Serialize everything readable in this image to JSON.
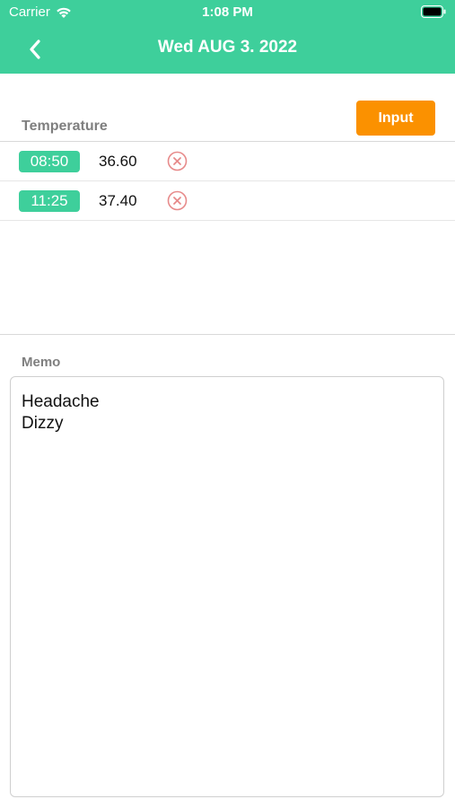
{
  "status_bar": {
    "carrier": "Carrier",
    "time": "1:08 PM",
    "wifi_icon": "wifi-icon",
    "battery_icon": "battery-full-icon"
  },
  "nav": {
    "title": "Wed AUG 3. 2022",
    "back_icon": "chevron-left-icon"
  },
  "temperature": {
    "label": "Temperature",
    "input_button_label": "Input",
    "entries": [
      {
        "time": "08:50",
        "value": "36.60",
        "delete_icon": "remove-circle-icon"
      },
      {
        "time": "11:25",
        "value": "37.40",
        "delete_icon": "remove-circle-icon"
      }
    ]
  },
  "memo": {
    "label": "Memo",
    "text": "Headache\nDizzy"
  },
  "colors": {
    "accent_green": "#3ecf9b",
    "button_orange": "#fb9100",
    "delete_red": "#e78a8a",
    "label_gray": "#7f7f7f"
  }
}
